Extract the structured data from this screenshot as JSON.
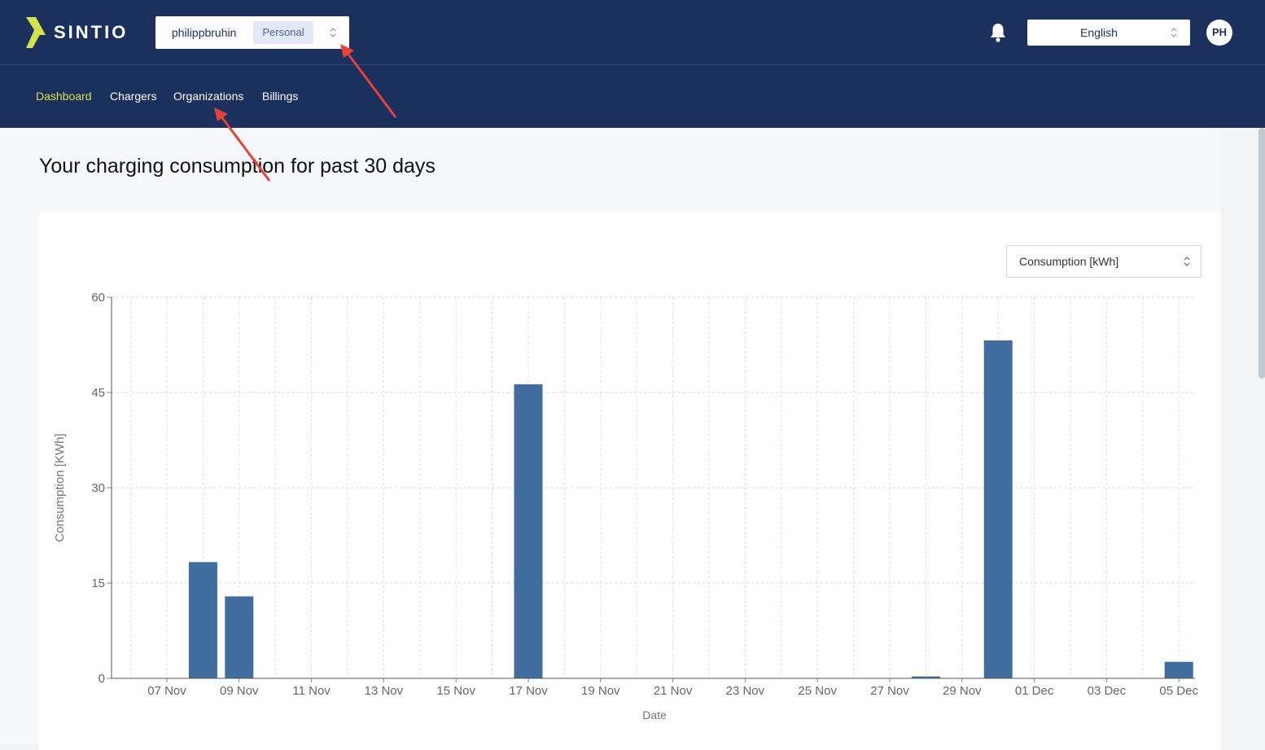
{
  "header": {
    "brand": "SINTIO",
    "account_name": "philippbruhin",
    "account_type": "Personal",
    "language": "English",
    "avatar_initials": "PH"
  },
  "nav": {
    "items": [
      {
        "label": "Dashboard",
        "active": true
      },
      {
        "label": "Chargers",
        "active": false
      },
      {
        "label": "Organizations",
        "active": false
      },
      {
        "label": "Billings",
        "active": false
      }
    ]
  },
  "main": {
    "title": "Your charging consumption for past 30 days",
    "metric_select_value": "Consumption [kWh]"
  },
  "colors": {
    "header_bg": "#1b305c",
    "nav_active": "#d4e34b",
    "bar": "#416c9e",
    "annotation_arrow": "#e8403a"
  },
  "icons": {
    "logo": "lightning-logo-icon",
    "bell": "bell-icon",
    "select_chevron": "chevron-up-down-icon"
  },
  "chart_data": {
    "type": "bar",
    "title": "",
    "xlabel": "Date",
    "ylabel": "Consumption [KWh]",
    "ylim": [
      0,
      60
    ],
    "yticks": [
      0,
      15,
      30,
      45,
      60
    ],
    "grid": true,
    "xtick_labels": [
      "07 Nov",
      "09 Nov",
      "11 Nov",
      "13 Nov",
      "15 Nov",
      "17 Nov",
      "19 Nov",
      "21 Nov",
      "23 Nov",
      "25 Nov",
      "27 Nov",
      "29 Nov",
      "01 Dec",
      "03 Dec",
      "05 Dec"
    ],
    "bars": [
      {
        "date": "2022-11-08",
        "value": 18.3
      },
      {
        "date": "2022-11-09",
        "value": 12.9
      },
      {
        "date": "2022-11-17",
        "value": 46.3
      },
      {
        "date": "2022-11-28",
        "value": 0.3
      },
      {
        "date": "2022-11-30",
        "value": 53.2
      },
      {
        "date": "2022-12-05",
        "value": 2.6
      }
    ]
  }
}
